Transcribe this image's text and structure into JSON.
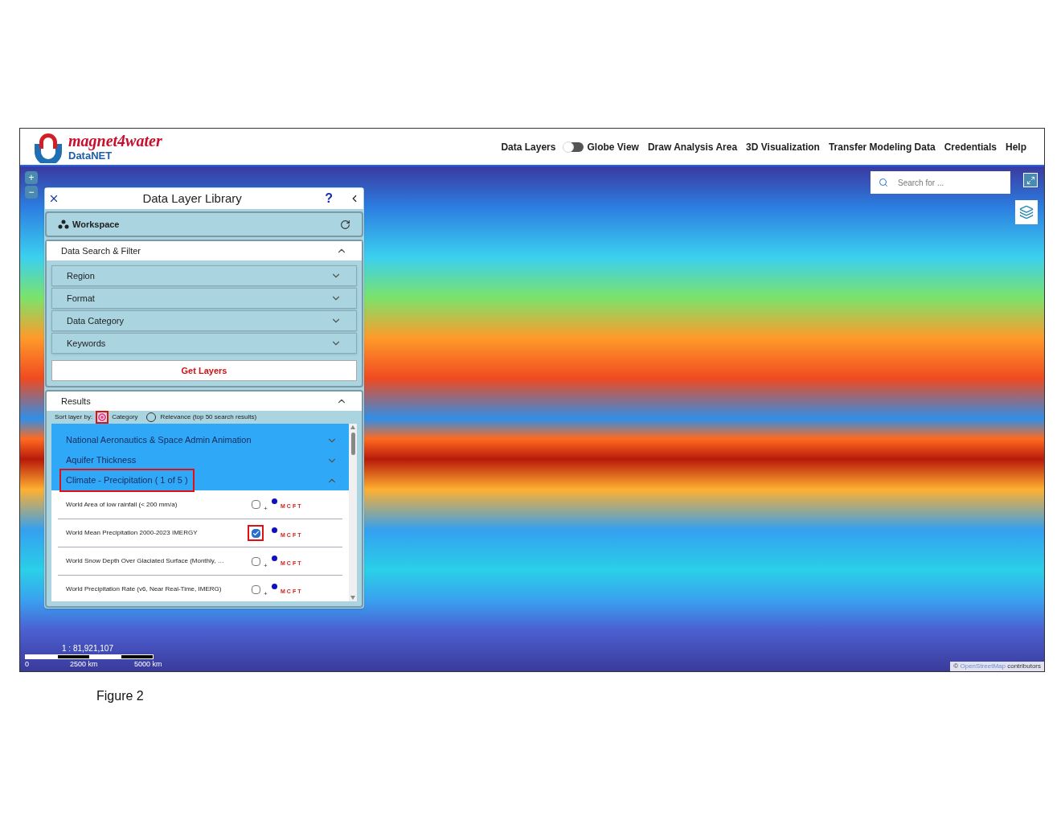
{
  "header": {
    "logo_script": "magnet4water",
    "logo_name": "DataNET",
    "nav": [
      {
        "kind": "link",
        "label": "Data Layers"
      },
      {
        "kind": "toggle",
        "label": "Globe View",
        "on": false
      },
      {
        "kind": "link",
        "label": "Draw Analysis Area"
      },
      {
        "kind": "link",
        "label": "3D Visualization"
      },
      {
        "kind": "link",
        "label": "Transfer Modeling Data"
      },
      {
        "kind": "link",
        "label": "Credentials"
      },
      {
        "kind": "link",
        "label": "Help"
      }
    ]
  },
  "map": {
    "zoom_in": "+",
    "zoom_out": "−",
    "search": {
      "placeholder": "Search for ..."
    },
    "scale_ratio": "1 : 81,921,107",
    "scale_labels": [
      "0",
      "2500 km",
      "5000 km"
    ],
    "attribution_symbol": "©",
    "attribution_link": "OpenStreetMap",
    "attribution_text": "contributors"
  },
  "panel": {
    "title": "Data Layer Library",
    "help": "?",
    "workspace": "Workspace",
    "filter": {
      "title": "Data Search & Filter",
      "expanded": true,
      "items": [
        "Region",
        "Format",
        "Data Category",
        "Keywords"
      ],
      "button": "Get Layers"
    },
    "results": {
      "title": "Results",
      "expanded": true,
      "sort_label": "Sort layer by:",
      "sort_options": [
        {
          "label": "Category",
          "selected": true,
          "highlighted": true
        },
        {
          "label": "Relevance (top 50 search results)",
          "selected": false,
          "highlighted": false
        }
      ],
      "categories": [
        {
          "label": "National Aeronautics & Space Admin Animation",
          "expanded": false,
          "highlighted": false
        },
        {
          "label": "Aquifer Thickness",
          "expanded": false,
          "highlighted": false
        },
        {
          "label": "Climate - Precipitation ( 1 of 5 )",
          "expanded": true,
          "highlighted": true
        }
      ],
      "layers": [
        {
          "name": "World Area of low rainfall (< 200 mm/a)",
          "checked": false,
          "highlighted": false,
          "plus": "+",
          "tag": "MCFT"
        },
        {
          "name": "World Mean Precipitation 2000-2023 IMERGY",
          "checked": true,
          "highlighted": true,
          "tag": "MCFT"
        },
        {
          "name": "World Snow Depth Over Glaciated Surface (Monthly, …",
          "checked": false,
          "highlighted": false,
          "plus": "+",
          "tag": "MCFT"
        },
        {
          "name": "World Precipitation Rate (v6, Near Real-Time, IMERG)",
          "checked": false,
          "highlighted": false,
          "plus": "+",
          "tag": "MCFT"
        }
      ]
    }
  },
  "caption": "Figure 2"
}
